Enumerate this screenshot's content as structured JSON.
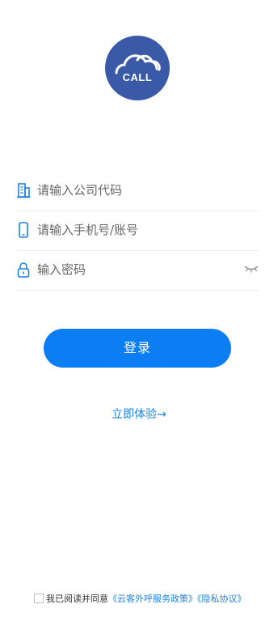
{
  "logo": {
    "text": "CALL"
  },
  "form": {
    "company_placeholder": "请输入公司代码",
    "account_placeholder": "请输入手机号/账号",
    "password_placeholder": "输入密码"
  },
  "login_label": "登录",
  "try_label": "立即体验→",
  "agreement": {
    "prefix": "我已阅读并同意",
    "service_policy": "《云客外呼服务政策》",
    "privacy": "《隐私协议》"
  },
  "colors": {
    "brand_logo": "#3a5aa8",
    "primary_button": "#0a7ef2",
    "link": "#1d82e0"
  },
  "icons": [
    "building-icon",
    "phone-icon",
    "lock-icon",
    "eye-closed-icon"
  ]
}
